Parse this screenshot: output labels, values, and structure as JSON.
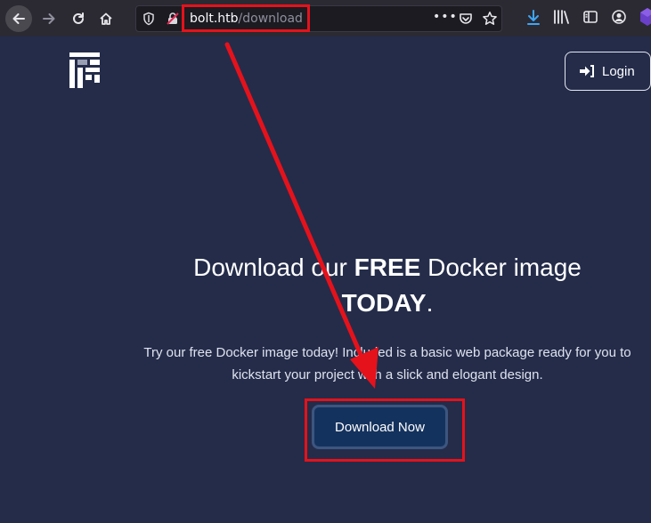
{
  "browser": {
    "url_host": "bolt.htb",
    "url_path": "/download",
    "icons": [
      "back-arrow-icon",
      "forward-arrow-icon",
      "reload-icon",
      "home-icon",
      "shield-icon",
      "insecure-lock-icon",
      "more-dots-icon",
      "pocket-icon",
      "star-icon",
      "download-icon",
      "library-icon",
      "sidebar-icon",
      "account-icon",
      "extension-icon"
    ]
  },
  "header": {
    "login_label": "Login"
  },
  "hero": {
    "title_part1": "Download our ",
    "title_bold1": "FREE",
    "title_part2": " Docker image",
    "title_bold2": "TODAY",
    "title_end": ".",
    "description": "Try our free Docker image today! Included is a basic web package ready for you to kickstart your project with a slick and elogant design.",
    "download_label": "Download Now"
  },
  "colors": {
    "background": "#242c4a",
    "button": "#14325e",
    "annotation": "#e5121b",
    "download_icon": "#3ea6f5"
  }
}
